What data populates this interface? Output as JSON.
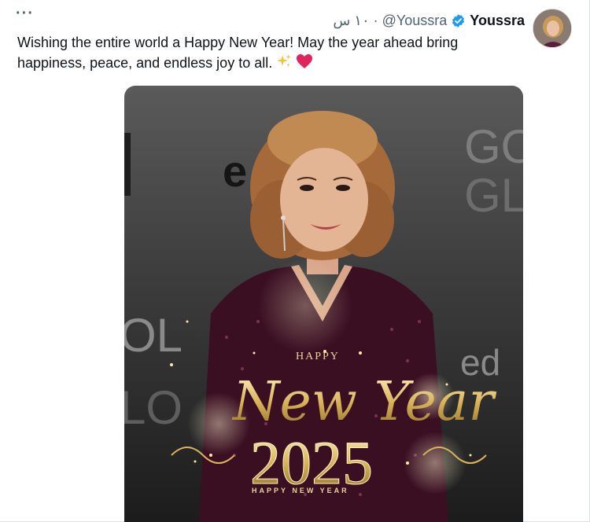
{
  "tweet": {
    "more_label": "···",
    "author_name": "Youssra",
    "handle": "@Youssra",
    "separator": "·",
    "time": "١٠ س",
    "text_line1": "Wishing the entire world a Happy New Year! May the year ahead bring",
    "text_line2": "happiness, peace, and endless joy to all.",
    "emojis": [
      "sparkles-icon",
      "red-heart-icon"
    ],
    "verified_icon": "verified-badge-icon",
    "verified_color": "#1d9bf0"
  },
  "media": {
    "happy_small": "HAPPY",
    "new_year_script": "New Year",
    "year": "2025",
    "happy_new_year_caption": "HAPPY   NEW   YEAR",
    "backdrop_text_1": "GO",
    "backdrop_text_2": "GL",
    "backdrop_text_3": "e",
    "backdrop_text_4": "ed",
    "backdrop_text_5": "OL",
    "backdrop_text_6": "LO",
    "accent_gold": "#d9b45a"
  }
}
